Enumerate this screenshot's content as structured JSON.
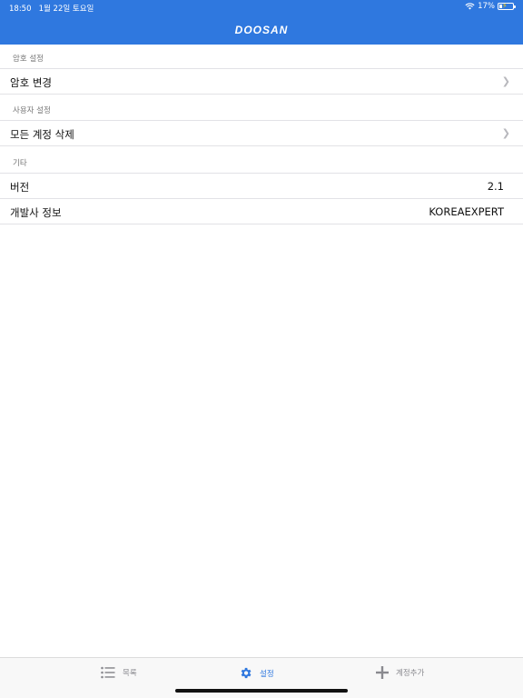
{
  "status_bar": {
    "time": "18:50",
    "date": "1월 22일 토요일",
    "battery": "17%"
  },
  "header": {
    "brand": "DOOSAN"
  },
  "sections": [
    {
      "title": "암호 설정",
      "rows": [
        {
          "label": "암호 변경",
          "value": ""
        }
      ]
    },
    {
      "title": "사용자 설정",
      "rows": [
        {
          "label": "모든 계정 삭제",
          "value": ""
        }
      ]
    },
    {
      "title": "기타",
      "rows": [
        {
          "label": "버전",
          "value": "2.1"
        },
        {
          "label": "개발사 정보",
          "value": "KOREAEXPERT"
        }
      ]
    }
  ],
  "tabs": [
    {
      "label": "목록",
      "icon": "list-icon"
    },
    {
      "label": "설정",
      "icon": "gear-icon",
      "active": true
    },
    {
      "label": "계정추가",
      "icon": "plus-icon"
    }
  ],
  "colors": {
    "accent": "#2f78df",
    "inactive": "#8a8a8f"
  }
}
